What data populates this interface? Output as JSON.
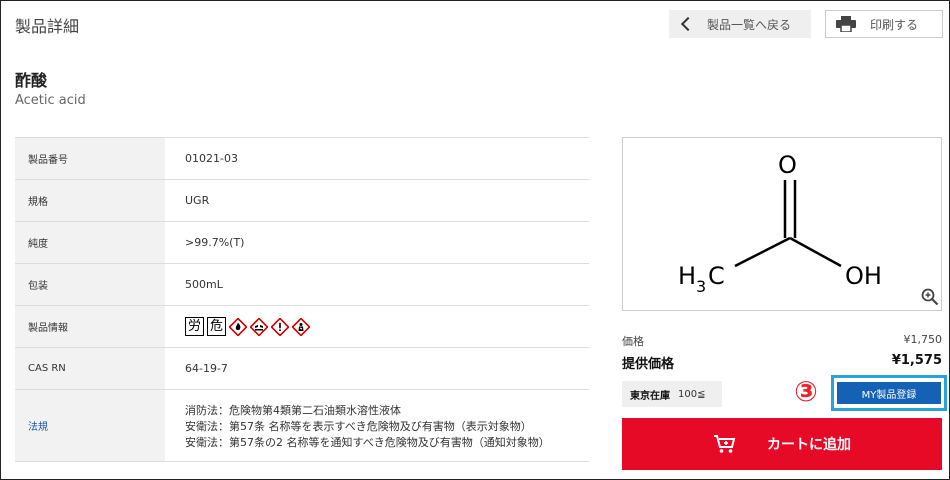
{
  "header": {
    "title": "製品詳細",
    "back_label": "製品一覧へ戻る",
    "print_label": "印刷する"
  },
  "product": {
    "name_jp": "酢酸",
    "name_en": "Acetic acid"
  },
  "specs": [
    {
      "label": "製品番号",
      "value": "01021-03"
    },
    {
      "label": "規格",
      "value": "UGR"
    },
    {
      "label": "純度",
      "value": ">99.7%(T)"
    },
    {
      "label": "包装",
      "value": "500mL"
    },
    {
      "label": "製品情報",
      "value": ""
    },
    {
      "label": "CAS RN",
      "value": "64-19-7"
    },
    {
      "label": "法規",
      "lines": [
        "消防法：危険物第4類第二石油類水溶性液体",
        "安衛法：第57条 名称等を表示すべき危険物及び有害物（表示対象物）",
        "安衛法：第57条の2 名称等を通知すべき危険物及び有害物（通知対象物）"
      ]
    }
  ],
  "product_info_marks": [
    "労",
    "危"
  ],
  "structure": {
    "o_label": "O",
    "h_label": "H",
    "h_sub": "3",
    "c_label": "C",
    "oh_label": "OH"
  },
  "pricing": {
    "price_label": "価格",
    "price_value": "¥1,750",
    "offer_label": "提供価格",
    "offer_value": "¥1,575"
  },
  "stock": {
    "location": "東京在庫",
    "qty": "100≦"
  },
  "annotation": {
    "step": "③"
  },
  "actions": {
    "my_product_label": "MY製品登録",
    "cart_label": "カートに追加"
  },
  "colors": {
    "cart_red": "#e60a26",
    "my_button_blue": "#1561b5",
    "highlight_border": "#29a3dc",
    "step_red": "#e8232e"
  }
}
